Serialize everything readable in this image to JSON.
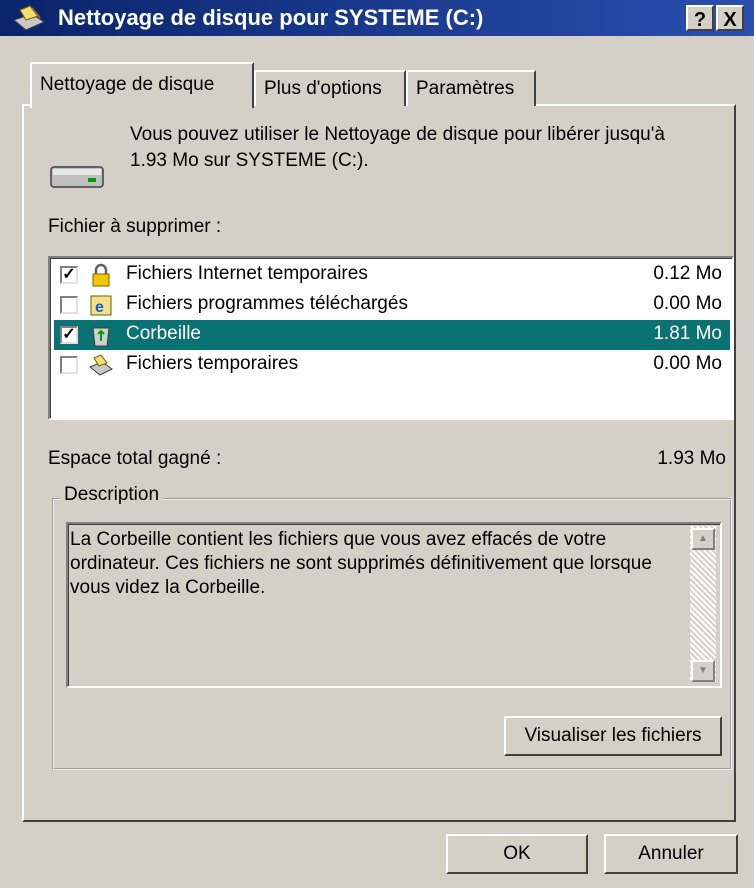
{
  "window": {
    "title": "Nettoyage de disque pour SYSTEME (C:)",
    "help_label": "?",
    "close_label": "X"
  },
  "tabs": [
    {
      "label": "Nettoyage de disque",
      "active": true
    },
    {
      "label": "Plus d'options",
      "active": false
    },
    {
      "label": "Paramètres",
      "active": false
    }
  ],
  "intro": {
    "line1": "Vous pouvez utiliser le Nettoyage de disque pour libérer jusqu'à",
    "line2": "1.93 Mo sur SYSTEME (C:)."
  },
  "files_label": "Fichier à supprimer :",
  "files": [
    {
      "name": "Fichiers Internet temporaires",
      "size": "0.12 Mo",
      "checked": true,
      "icon": "lock-icon",
      "selected": false
    },
    {
      "name": "Fichiers programmes téléchargés",
      "size": "0.00 Mo",
      "checked": false,
      "icon": "ie-icon",
      "selected": false
    },
    {
      "name": "Corbeille",
      "size": "1.81 Mo",
      "checked": true,
      "icon": "recycle-bin-icon",
      "selected": true
    },
    {
      "name": "Fichiers temporaires",
      "size": "0.00 Mo",
      "checked": false,
      "icon": "cleanup-icon",
      "selected": false
    }
  ],
  "total": {
    "label": "Espace total gagné :",
    "value": "1.93 Mo"
  },
  "description": {
    "legend": "Description",
    "text": "La Corbeille contient les fichiers que vous avez effacés de votre ordinateur. Ces fichiers ne sont supprimés définitivement que lorsque vous videz la Corbeille."
  },
  "buttons": {
    "view_files": "Visualiser les fichiers",
    "ok": "OK",
    "cancel": "Annuler"
  },
  "colors": {
    "selection": "#0a7272",
    "titlebar": "#0a246a",
    "face": "#d4d0c8"
  }
}
